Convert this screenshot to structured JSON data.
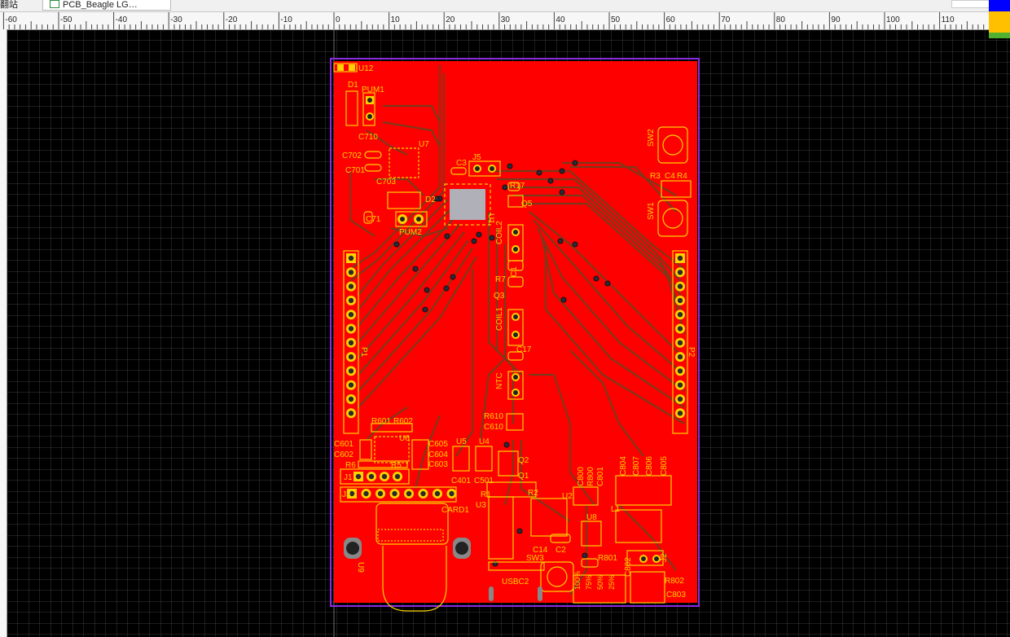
{
  "window": {
    "left_tab_label": "翻站",
    "document_tab_label": "PCB_Beagle LG…"
  },
  "ruler": {
    "labels": [
      "-60",
      "-50",
      "-40",
      "-30",
      "-20",
      "-10",
      "0",
      "10",
      "20",
      "30",
      "40",
      "50",
      "60",
      "70",
      "80",
      "90",
      "100",
      "110"
    ]
  },
  "colors": {
    "canvas_bg": "#000000",
    "grid": "#3a3a3a",
    "board_copper": "#ff0000",
    "trace": "#7a3a1a",
    "silkscreen": "#ffd200",
    "outline": "#8a2be2",
    "layer_blue": "#0000ff",
    "layer_orange": "#ffc000",
    "layer_green": "#50b030"
  },
  "components": [
    {
      "id": "u12",
      "label": "U12"
    },
    {
      "id": "d1",
      "label": "D1"
    },
    {
      "id": "pum1",
      "label": "PUM1"
    },
    {
      "id": "c710",
      "label": "C710"
    },
    {
      "id": "c702",
      "label": "C702"
    },
    {
      "id": "c701",
      "label": "C701"
    },
    {
      "id": "u7",
      "label": "U7"
    },
    {
      "id": "c703",
      "label": "C703"
    },
    {
      "id": "c3",
      "label": "C3"
    },
    {
      "id": "j5",
      "label": "J5"
    },
    {
      "id": "d2",
      "label": "D2"
    },
    {
      "id": "c71",
      "label": "C71"
    },
    {
      "id": "pum2",
      "label": "PUM2"
    },
    {
      "id": "u1",
      "label": "U1"
    },
    {
      "id": "r17",
      "label": "R17"
    },
    {
      "id": "q5",
      "label": "Q5"
    },
    {
      "id": "sw2",
      "label": "SW2"
    },
    {
      "id": "sw1",
      "label": "SW1"
    },
    {
      "id": "r3",
      "label": "R3"
    },
    {
      "id": "c4",
      "label": "C4"
    },
    {
      "id": "r4",
      "label": "R4"
    },
    {
      "id": "coil2",
      "label": "COIL2"
    },
    {
      "id": "c1",
      "label": "C1"
    },
    {
      "id": "r7",
      "label": "R7"
    },
    {
      "id": "q3",
      "label": "Q3"
    },
    {
      "id": "coil1",
      "label": "COIL1"
    },
    {
      "id": "c17",
      "label": "C17"
    },
    {
      "id": "ntc",
      "label": "NTC"
    },
    {
      "id": "p1",
      "label": "P1"
    },
    {
      "id": "p2",
      "label": "P2"
    },
    {
      "id": "r610",
      "label": "R610"
    },
    {
      "id": "c610",
      "label": "C610"
    },
    {
      "id": "r601",
      "label": "R601"
    },
    {
      "id": "r602",
      "label": "R602"
    },
    {
      "id": "u6",
      "label": "U6"
    },
    {
      "id": "c601",
      "label": "C601"
    },
    {
      "id": "c602",
      "label": "C602"
    },
    {
      "id": "c605",
      "label": "C605"
    },
    {
      "id": "c604",
      "label": "C604"
    },
    {
      "id": "c603",
      "label": "C603"
    },
    {
      "id": "u5",
      "label": "U5"
    },
    {
      "id": "u4",
      "label": "U4"
    },
    {
      "id": "r6",
      "label": "R6"
    },
    {
      "id": "r5",
      "label": "R5"
    },
    {
      "id": "j1",
      "label": "J1"
    },
    {
      "id": "c401",
      "label": "C401"
    },
    {
      "id": "c501",
      "label": "C501"
    },
    {
      "id": "q2",
      "label": "Q2"
    },
    {
      "id": "q1",
      "label": "Q1"
    },
    {
      "id": "j3",
      "label": "J3"
    },
    {
      "id": "r1",
      "label": "R1"
    },
    {
      "id": "r2",
      "label": "R2"
    },
    {
      "id": "u2",
      "label": "U2"
    },
    {
      "id": "card1",
      "label": "CARD1"
    },
    {
      "id": "u3",
      "label": "U3"
    },
    {
      "id": "c800",
      "label": "C800"
    },
    {
      "id": "r800",
      "label": "R800"
    },
    {
      "id": "c801",
      "label": "C801"
    },
    {
      "id": "c804",
      "label": "C804"
    },
    {
      "id": "c807",
      "label": "C807"
    },
    {
      "id": "c806",
      "label": "C806"
    },
    {
      "id": "c805",
      "label": "C805"
    },
    {
      "id": "l1",
      "label": "L1"
    },
    {
      "id": "u8",
      "label": "U8"
    },
    {
      "id": "c14",
      "label": "C14"
    },
    {
      "id": "c2",
      "label": "C2"
    },
    {
      "id": "sw3",
      "label": "SW3"
    },
    {
      "id": "r801",
      "label": "R801"
    },
    {
      "id": "c802",
      "label": "C802"
    },
    {
      "id": "j2",
      "label": "J2"
    },
    {
      "id": "u9",
      "label": "U9"
    },
    {
      "id": "usbc2",
      "label": "USBC2"
    },
    {
      "id": "led100",
      "label": "100%"
    },
    {
      "id": "led75",
      "label": "75%"
    },
    {
      "id": "led50",
      "label": "50%"
    },
    {
      "id": "led25",
      "label": "25%"
    },
    {
      "id": "r802",
      "label": "R802"
    },
    {
      "id": "c803",
      "label": "C803"
    }
  ]
}
